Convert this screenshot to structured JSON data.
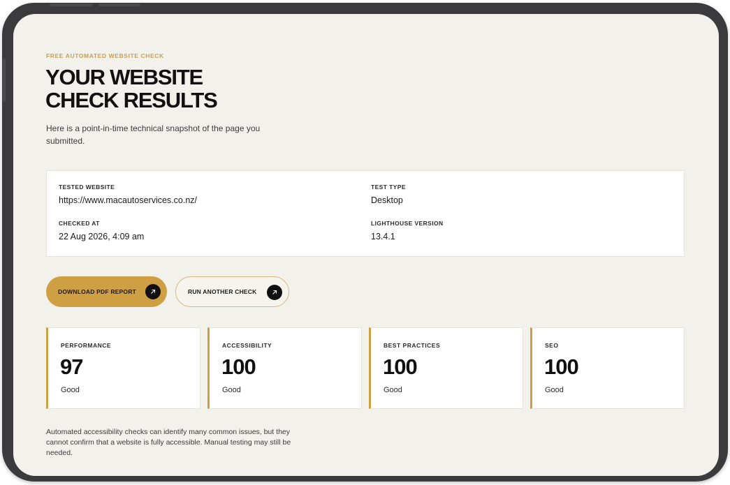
{
  "hero": {
    "eyebrow": "FREE AUTOMATED WEBSITE CHECK",
    "title_line1": "YOUR WEBSITE",
    "title_line2": "CHECK RESULTS",
    "subtitle": "Here is a point-in-time technical snapshot of the page you submitted."
  },
  "details": {
    "tested_website_label": "TESTED WEBSITE",
    "tested_website_value": "https://www.macautoservices.co.nz/",
    "test_type_label": "TEST TYPE",
    "test_type_value": "Desktop",
    "checked_at_label": "CHECKED AT",
    "checked_at_value": "22 Aug 2026, 4:09 am",
    "lighthouse_label": "LIGHTHOUSE VERSION",
    "lighthouse_value": "13.4.1"
  },
  "actions": {
    "download_label": "DOWNLOAD PDF REPORT",
    "rerun_label": "RUN ANOTHER CHECK",
    "arrow_icon": "arrow-up-right-icon"
  },
  "scores": [
    {
      "label": "PERFORMANCE",
      "value": "97",
      "status": "Good"
    },
    {
      "label": "ACCESSIBILITY",
      "value": "100",
      "status": "Good"
    },
    {
      "label": "BEST PRACTICES",
      "value": "100",
      "status": "Good"
    },
    {
      "label": "SEO",
      "value": "100",
      "status": "Good"
    }
  ],
  "footnote": "Automated accessibility checks can identify many common issues, but they cannot confirm that a website is fully accessible. Manual testing may still be needed.",
  "colors": {
    "accent": "#cfa043",
    "background": "#f3f1ec",
    "device_frame": "#3b3b3e",
    "text": "#111111"
  }
}
